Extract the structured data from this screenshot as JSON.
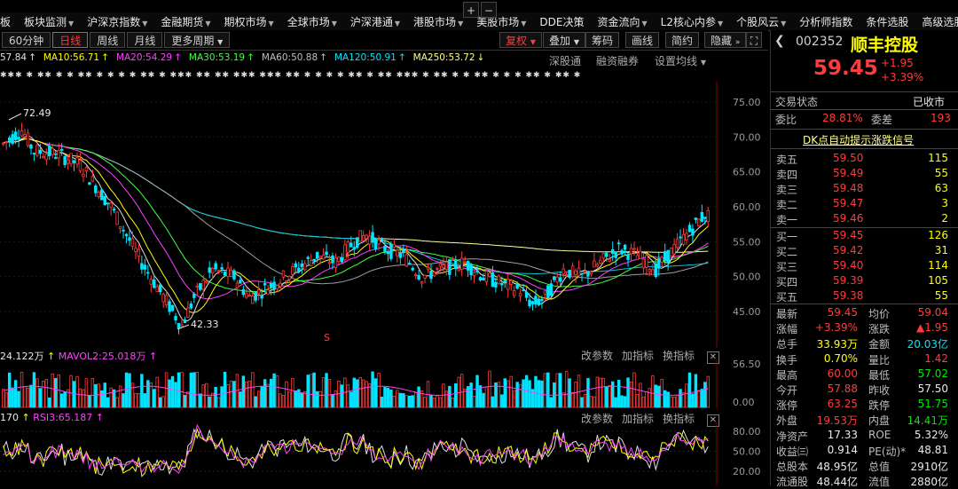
{
  "nav": {
    "items": [
      "板",
      "板块监测",
      "沪深京指数",
      "金融期货",
      "期权市场",
      "全球市场",
      "沪深港通",
      "港股市场",
      "美股市场",
      "DDE决策",
      "资金流向",
      "L2核心内参",
      "个股风云",
      "分析师指数",
      "条件选股",
      "高级选股"
    ],
    "has_arrow": [
      false,
      true,
      true,
      true,
      true,
      true,
      true,
      true,
      true,
      false,
      true,
      true,
      true,
      false,
      false,
      false
    ]
  },
  "toolbar": {
    "periods": [
      "60分钟",
      "日线",
      "周线",
      "月线",
      "更多周期"
    ],
    "active_period": "日线",
    "right_buttons": [
      "+",
      "−",
      "复权",
      "叠加",
      "筹码",
      "画线",
      "简约",
      "隐藏"
    ]
  },
  "ma_legend": [
    {
      "label": "57.84",
      "color": "#e0e0e0"
    },
    {
      "label": "MA10:56.71",
      "color": "#ffff00"
    },
    {
      "label": "MA20:54.29",
      "color": "#ff40ff"
    },
    {
      "label": "MA30:53.19",
      "color": "#40ff40"
    },
    {
      "label": "MA60:50.88",
      "color": "#c0c0c0"
    },
    {
      "label": "MA120:50.91",
      "color": "#00e5ff"
    },
    {
      "label": "MA250:53.72",
      "color": "#ffff80"
    }
  ],
  "chart_options": [
    "深股通",
    "融资融券",
    "设置均线"
  ],
  "price_axis": [
    "75.00",
    "70.00",
    "65.00",
    "60.00",
    "55.00",
    "50.00",
    "45.00"
  ],
  "annotations": {
    "high": "72.49",
    "low": "42.33",
    "marker": "S"
  },
  "volume": {
    "title": "24.122万",
    "mavol2": "MAVOL2:25.018万",
    "buttons": [
      "改参数",
      "加指标",
      "换指标"
    ],
    "axis": [
      "56.50",
      "0.00"
    ]
  },
  "rsi": {
    "title": "170",
    "rsi3": "RSI3:65.187",
    "buttons": [
      "改参数",
      "加指标",
      "换指标"
    ],
    "axis": [
      "80.00",
      "50.00",
      "20.00"
    ]
  },
  "quote": {
    "code": "002352",
    "name": "顺丰控股",
    "price": "59.45",
    "change": "+1.95",
    "change_pct": "+3.39%",
    "status_label": "交易状态",
    "status": "已收市",
    "weibi_label": "委比",
    "weibi": "28.81%",
    "weicha_label": "委差",
    "weicha": "193",
    "dk_signal": "DK点自动提示涨跌信号",
    "asks": [
      {
        "label": "卖五",
        "price": "59.50",
        "vol": "115"
      },
      {
        "label": "卖四",
        "price": "59.49",
        "vol": "55"
      },
      {
        "label": "卖三",
        "price": "59.48",
        "vol": "63"
      },
      {
        "label": "卖二",
        "price": "59.47",
        "vol": "3"
      },
      {
        "label": "卖一",
        "price": "59.46",
        "vol": "2"
      }
    ],
    "bids": [
      {
        "label": "买一",
        "price": "59.45",
        "vol": "126"
      },
      {
        "label": "买二",
        "price": "59.42",
        "vol": "31"
      },
      {
        "label": "买三",
        "price": "59.40",
        "vol": "114"
      },
      {
        "label": "买四",
        "price": "59.39",
        "vol": "105"
      },
      {
        "label": "买五",
        "price": "59.38",
        "vol": "55"
      }
    ],
    "stats": [
      {
        "l1": "最新",
        "v1": "59.45",
        "c1": "red",
        "l2": "均价",
        "v2": "59.04",
        "c2": "red"
      },
      {
        "l1": "涨幅",
        "v1": "+3.39%",
        "c1": "red",
        "l2": "涨跌",
        "v2": "▲1.95",
        "c2": "red"
      },
      {
        "l1": "总手",
        "v1": "33.93万",
        "c1": "yellow",
        "l2": "金额",
        "v2": "20.03亿",
        "c2": "cyan"
      },
      {
        "l1": "换手",
        "v1": "0.70%",
        "c1": "yellow",
        "l2": "量比",
        "v2": "1.42",
        "c2": "red"
      },
      {
        "l1": "最高",
        "v1": "60.00",
        "c1": "red",
        "l2": "最低",
        "v2": "57.02",
        "c2": "green"
      },
      {
        "l1": "今开",
        "v1": "57.88",
        "c1": "red",
        "l2": "昨收",
        "v2": "57.50",
        "c2": "white"
      },
      {
        "l1": "涨停",
        "v1": "63.25",
        "c1": "red",
        "l2": "跌停",
        "v2": "51.75",
        "c2": "green"
      },
      {
        "l1": "外盘",
        "v1": "19.53万",
        "c1": "red",
        "l2": "内盘",
        "v2": "14.41万",
        "c2": "green"
      },
      {
        "l1": "净资产",
        "v1": "17.33",
        "c1": "white",
        "l2": "ROE",
        "v2": "5.32%",
        "c2": "white"
      },
      {
        "l1": "收益㈢",
        "v1": "0.914",
        "c1": "white",
        "l2": "PE(动)*",
        "v2": "48.81",
        "c2": "white"
      },
      {
        "l1": "总股本",
        "v1": "48.95亿",
        "c1": "white",
        "l2": "总值",
        "v2": "2910亿",
        "c2": "white"
      },
      {
        "l1": "流通股",
        "v1": "48.44亿",
        "c1": "white",
        "l2": "流值",
        "v2": "2880亿",
        "c2": "white"
      }
    ]
  }
}
